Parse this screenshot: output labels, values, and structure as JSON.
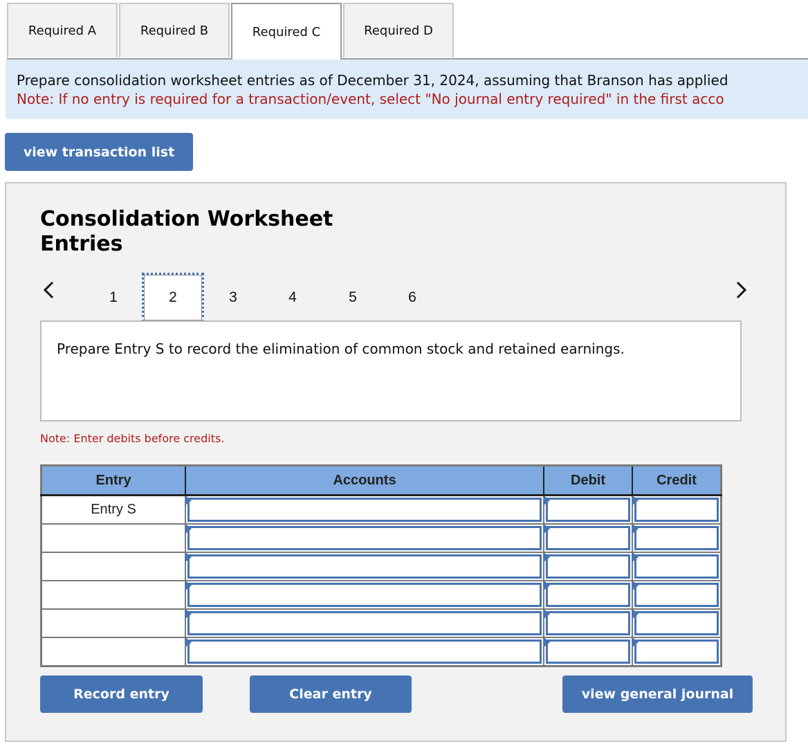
{
  "tabs": [
    {
      "label": "Required A",
      "active": false
    },
    {
      "label": "Required B",
      "active": false
    },
    {
      "label": "Required C",
      "active": true
    },
    {
      "label": "Required D",
      "active": false
    }
  ],
  "instructions": {
    "line1": "Prepare consolidation worksheet entries as of December 31, 2024, assuming that Branson has applied",
    "line2": "Note: If no entry is required for a transaction/event, select \"No journal entry required\" in the first acco"
  },
  "view_transaction_list_label": "view transaction list",
  "panel": {
    "title": "Consolidation Worksheet Entries",
    "pager": {
      "prev_icon": "chevron-left-icon",
      "next_icon": "chevron-right-icon",
      "pages": [
        "1",
        "2",
        "3",
        "4",
        "5",
        "6"
      ],
      "current_page": "2"
    },
    "prompt": "Prepare Entry S to record the elimination of common stock and retained earnings.",
    "note": "Note: Enter debits before credits."
  },
  "journal_table": {
    "headers": [
      "Entry",
      "Accounts",
      "Debit",
      "Credit"
    ],
    "rows": [
      {
        "entry": "Entry S",
        "account": "",
        "debit": "",
        "credit": ""
      },
      {
        "entry": "",
        "account": "",
        "debit": "",
        "credit": ""
      },
      {
        "entry": "",
        "account": "",
        "debit": "",
        "credit": ""
      },
      {
        "entry": "",
        "account": "",
        "debit": "",
        "credit": ""
      },
      {
        "entry": "",
        "account": "",
        "debit": "",
        "credit": ""
      },
      {
        "entry": "",
        "account": "",
        "debit": "",
        "credit": ""
      }
    ]
  },
  "buttons": {
    "record": "Record entry",
    "clear": "Clear entry",
    "view_journal": "view general journal"
  },
  "colors": {
    "button_blue": "#4674b3",
    "header_blue": "#7eaadf",
    "note_red": "#b01c1c",
    "instr_bg": "#dcebf7",
    "panel_bg": "#f2f2f2"
  }
}
